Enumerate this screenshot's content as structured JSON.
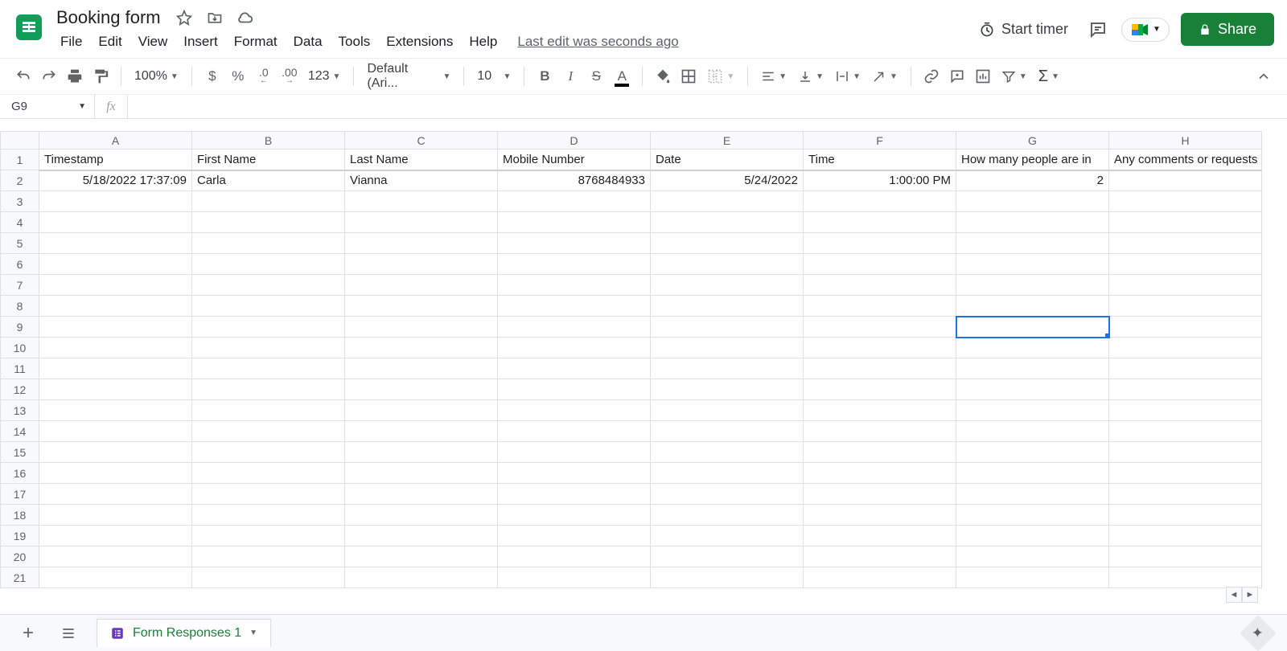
{
  "doc": {
    "title": "Booking form",
    "last_edit": "Last edit was seconds ago"
  },
  "menus": {
    "file": "File",
    "edit": "Edit",
    "view": "View",
    "insert": "Insert",
    "format": "Format",
    "data": "Data",
    "tools": "Tools",
    "extensions": "Extensions",
    "help": "Help"
  },
  "header_right": {
    "timer": "Start timer",
    "share": "Share"
  },
  "toolbar": {
    "zoom": "100%",
    "currency": "$",
    "percent": "%",
    "dec_minus": ".0",
    "dec_plus": ".00",
    "fmt_more": "123",
    "font": "Default (Ari...",
    "font_size": "10"
  },
  "namebox": "G9",
  "columns": [
    "A",
    "B",
    "C",
    "D",
    "E",
    "F",
    "G",
    "H"
  ],
  "row_count": 21,
  "selected": {
    "row": 9,
    "col": "G"
  },
  "headers": {
    "A": "Timestamp",
    "B": "First Name",
    "C": "Last Name",
    "D": "Mobile Number",
    "E": "Date",
    "F": "Time",
    "G": "How many people are in",
    "H": "Any comments or requests"
  },
  "data_rows": [
    {
      "A": "5/18/2022 17:37:09",
      "B": "Carla",
      "C": "Vianna",
      "D": "8768484933",
      "E": "5/24/2022",
      "F": "1:00:00 PM",
      "G": "2",
      "H": ""
    }
  ],
  "right_align_cols": [
    "A",
    "D",
    "E",
    "F",
    "G"
  ],
  "sheet_tab": "Form Responses 1"
}
